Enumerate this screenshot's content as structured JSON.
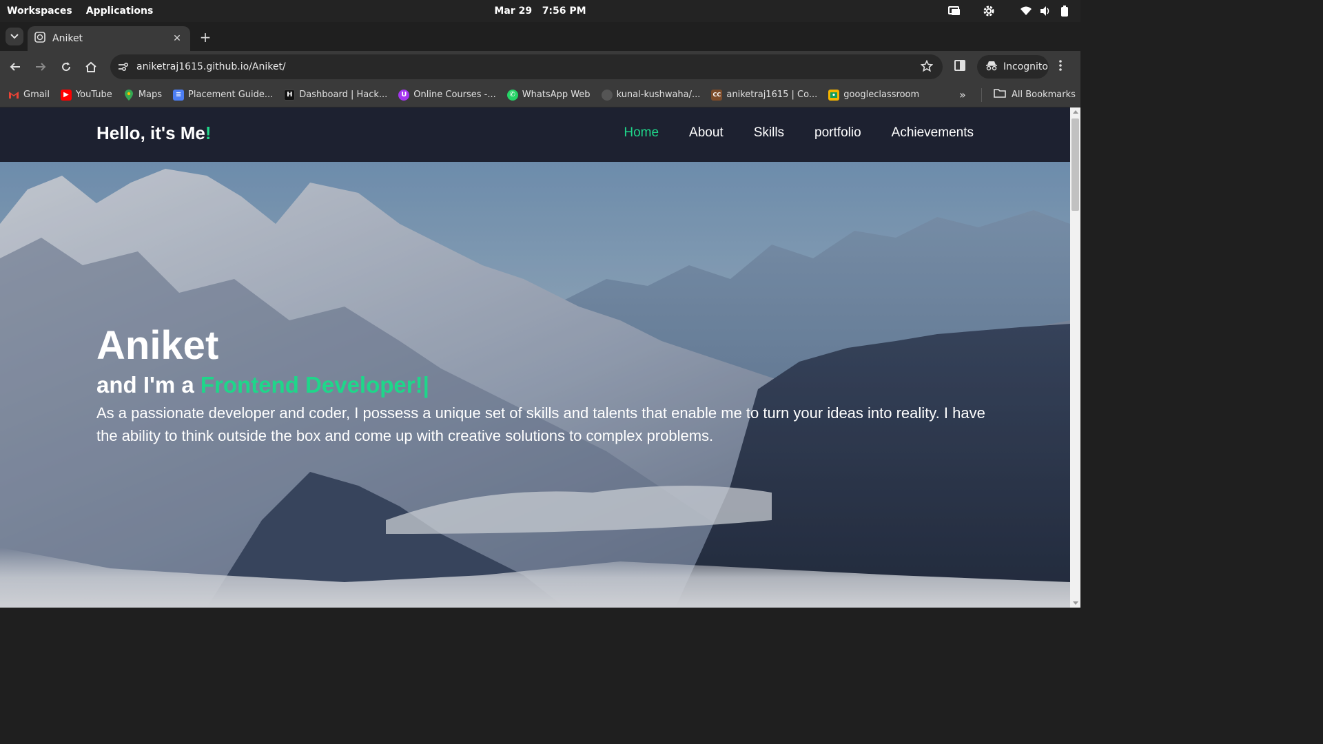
{
  "system_bar": {
    "workspaces": "Workspaces",
    "applications": "Applications",
    "date": "Mar 29",
    "time": "7:56 PM"
  },
  "browser": {
    "tab": {
      "title": "Aniket"
    },
    "url": "aniketraj1615.github.io/Aniket/",
    "incognito_label": "Incognito",
    "bookmarks": [
      {
        "label": "Gmail",
        "icon": "gmail-icon",
        "color": "#ea4335"
      },
      {
        "label": "YouTube",
        "icon": "youtube-icon",
        "color": "#ff0000"
      },
      {
        "label": "Maps",
        "icon": "maps-icon",
        "color": "#34a853"
      },
      {
        "label": "Placement Guide...",
        "icon": "docs-icon",
        "color": "#4c7ef3"
      },
      {
        "label": "Dashboard | Hack...",
        "icon": "hackerrank-icon",
        "color": "#111111"
      },
      {
        "label": "Online Courses -...",
        "icon": "udemy-icon",
        "color": "#a435f0"
      },
      {
        "label": "WhatsApp Web",
        "icon": "whatsapp-icon",
        "color": "#25d366"
      },
      {
        "label": "kunal-kushwaha/...",
        "icon": "github-icon",
        "color": "#555555"
      },
      {
        "label": "aniketraj1615 | Co...",
        "icon": "codechef-icon",
        "color": "#7b4b2a"
      },
      {
        "label": "googleclassroom",
        "icon": "classroom-icon",
        "color": "#f4b400"
      }
    ],
    "all_bookmarks": "All Bookmarks"
  },
  "site": {
    "logo_text": "Hello, it's Me",
    "logo_accent": "!",
    "nav": [
      "Home",
      "About",
      "Skills",
      "portfolio",
      "Achievements"
    ],
    "active_nav": "Home",
    "hero": {
      "name": "Aniket",
      "role_prefix": "and I'm a ",
      "role_highlight": "Frontend Developer!",
      "role_cursor": "|",
      "description": "As a passionate developer and coder, I possess a unique set of skills and talents that enable me to turn your ideas into reality. I have the ability to think outside the box and come up with creative solutions to complex problems."
    },
    "colors": {
      "accent": "#1fd68a",
      "nav_bg": "#1d2130"
    }
  }
}
